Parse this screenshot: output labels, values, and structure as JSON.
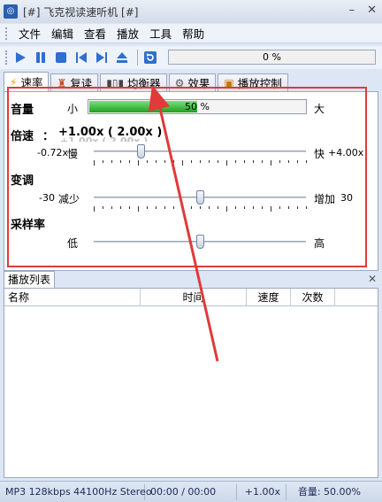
{
  "window": {
    "title": "[#] 飞克视读速听机 [#]",
    "minimize": "–",
    "close": "✕"
  },
  "menu": [
    "文件",
    "编辑",
    "查看",
    "播放",
    "工具",
    "帮助"
  ],
  "toolbar": {
    "progress_text": "0 %"
  },
  "tabs": [
    "速率",
    "复读",
    "均衡器",
    "效果",
    "播放控制"
  ],
  "volume": {
    "label": "音量",
    "min": "小",
    "max": "大",
    "value_text": "50 %",
    "fraction": 0.5
  },
  "speed": {
    "label": "倍速",
    "colon": "：",
    "value": "+1.00x ( 2.00x )",
    "ghost": "+1.00x ( 2.00x )",
    "min_value": "-0.72x",
    "min_label": "慢",
    "max_label": "快",
    "max_value": "+4.00x",
    "fraction": 0.22
  },
  "pitch": {
    "label": "变调",
    "min_value": "-30",
    "min_label": "减少",
    "max_label": "增加",
    "max_value": "30",
    "fraction": 0.5
  },
  "sample_rate": {
    "label": "采样率",
    "min_label": "低",
    "max_label": "高",
    "fraction": 0.5
  },
  "playlist": {
    "tab": "播放列表",
    "close": "✕",
    "columns": [
      "名称",
      "时间",
      "速度",
      "次数"
    ]
  },
  "status": {
    "format": "MP3 128kbps 44100Hz Stereo",
    "time": "00:00 / 00:00",
    "speed": "+1.00x",
    "volume": "音量: 50.00%"
  },
  "colors": {
    "accent": "#2a5fb0",
    "highlight": "#e03a3a",
    "volume_fill": "#1fa01f"
  }
}
